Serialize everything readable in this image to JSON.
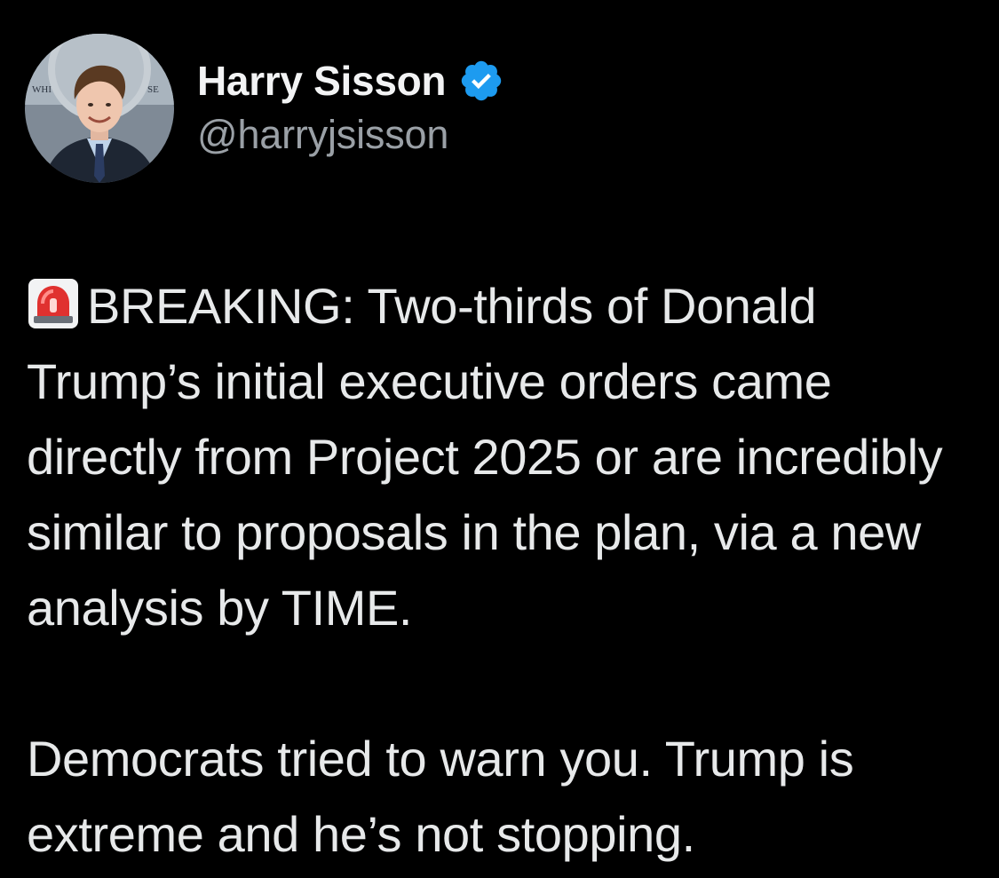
{
  "author": {
    "display_name": "Harry Sisson",
    "handle": "@harryjsisson",
    "verified": true,
    "verified_icon": "verified-badge-icon",
    "verified_color": "#1d9bf0",
    "avatar_sign_left": "WHI",
    "avatar_sign_right": "SE"
  },
  "tweet": {
    "leading_emoji": "rotating-light-icon",
    "paragraph_1": "BREAKING: Two-thirds of Donald Trump’s initial executive orders came directly from Project 2025 or are incredibly similar to proposals in the plan, via a new analysis by TIME.",
    "paragraph_2": "Democrats tried to warn you. Trump is extreme and he’s not stopping."
  },
  "colors": {
    "background": "#000000",
    "text": "#e7e9ea",
    "secondary_text": "#9aa0a6"
  }
}
